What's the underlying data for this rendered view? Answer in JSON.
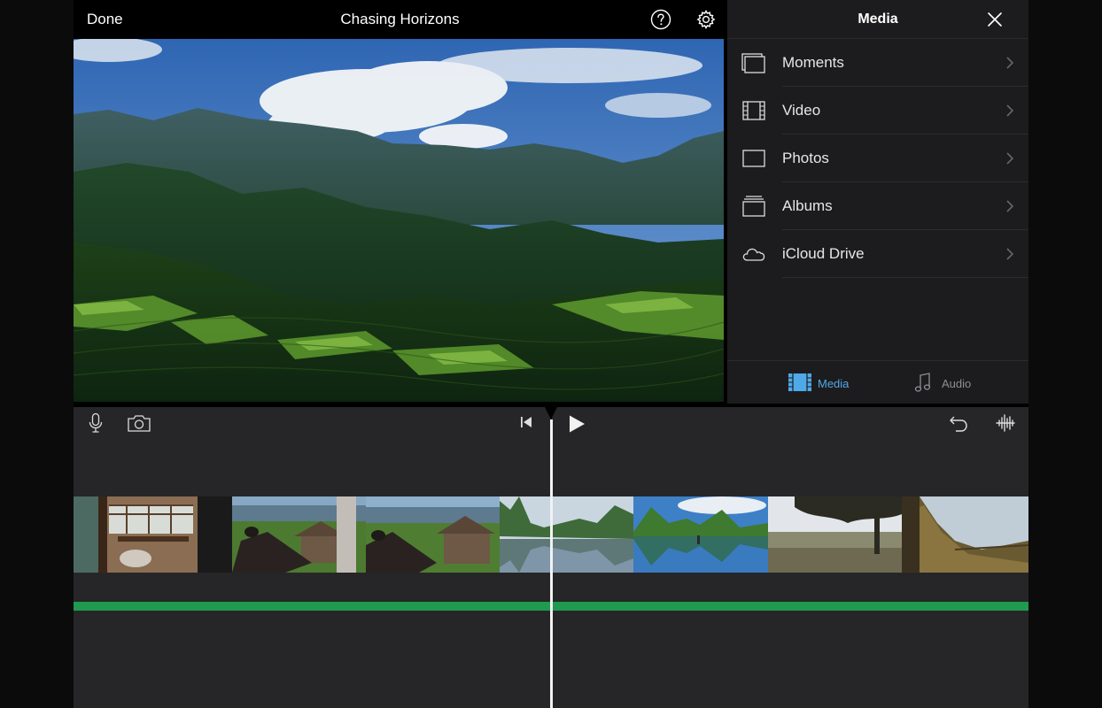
{
  "topbar": {
    "done_label": "Done",
    "project_title": "Chasing Horizons"
  },
  "media_panel": {
    "title": "Media",
    "items": [
      {
        "label": "Moments",
        "icon": "moments-icon"
      },
      {
        "label": "Video",
        "icon": "film-icon"
      },
      {
        "label": "Photos",
        "icon": "photo-frame-icon"
      },
      {
        "label": "Albums",
        "icon": "albums-icon"
      },
      {
        "label": "iCloud Drive",
        "icon": "cloud-icon"
      }
    ],
    "tabs": [
      {
        "label": "Media",
        "icon": "film-icon",
        "selected": true
      },
      {
        "label": "Audio",
        "icon": "music-note-icon",
        "selected": false
      }
    ]
  },
  "timeline": {
    "tools": [
      "microphone-icon",
      "camera-icon",
      "skip-to-start-icon",
      "play-icon",
      "undo-icon",
      "waveform-icon"
    ]
  },
  "colors": {
    "accent": "#4fa9e8",
    "audio_track": "#1f9a4e",
    "panel_bg": "#1c1c1e",
    "timeline_bg": "#262628"
  }
}
